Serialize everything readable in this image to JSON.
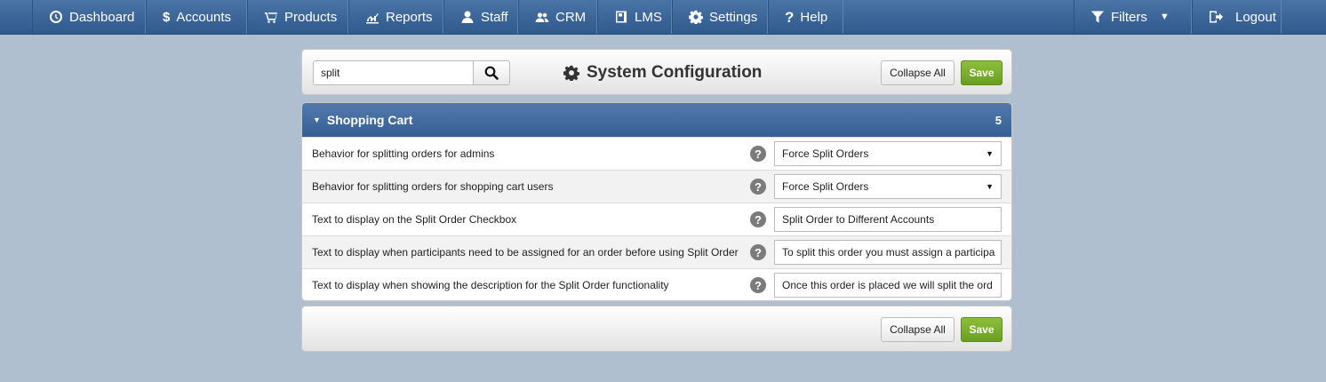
{
  "nav": {
    "left": [
      {
        "label": "Dashboard",
        "icon": "dashboard-icon"
      },
      {
        "label": "Accounts",
        "icon": "dollar-icon"
      },
      {
        "label": "Products",
        "icon": "cart-icon"
      },
      {
        "label": "Reports",
        "icon": "chart-icon"
      },
      {
        "label": "Staff",
        "icon": "user-icon"
      },
      {
        "label": "CRM",
        "icon": "users-icon"
      },
      {
        "label": "LMS",
        "icon": "book-icon"
      },
      {
        "label": "Settings",
        "icon": "gear-icon"
      },
      {
        "label": "Help",
        "icon": "question-icon"
      }
    ],
    "filters_label": "Filters",
    "logout_label": "Logout"
  },
  "search": {
    "value": "split"
  },
  "page": {
    "title": "System Configuration"
  },
  "toolbar": {
    "collapse_label": "Collapse All",
    "save_label": "Save"
  },
  "section": {
    "title": "Shopping Cart",
    "count": "5",
    "rows": [
      {
        "label": "Behavior for splitting orders for admins",
        "value": "Force Split Orders",
        "type": "select"
      },
      {
        "label": "Behavior for splitting orders for shopping cart users",
        "value": "Force Split Orders",
        "type": "select"
      },
      {
        "label": "Text to display on the Split Order Checkbox",
        "value": "Split Order to Different Accounts",
        "type": "text"
      },
      {
        "label": "Text to display when participants need to be assigned for an order before using Split Order",
        "value": "To split this order you must assign a participa",
        "type": "text"
      },
      {
        "label": "Text to display when showing the description for the Split Order functionality",
        "value": "Once this order is placed we will split the ord",
        "type": "text"
      }
    ]
  },
  "colors": {
    "nav": "#3a6598",
    "save": "#7aad2c",
    "section_header": "#4570a5"
  }
}
